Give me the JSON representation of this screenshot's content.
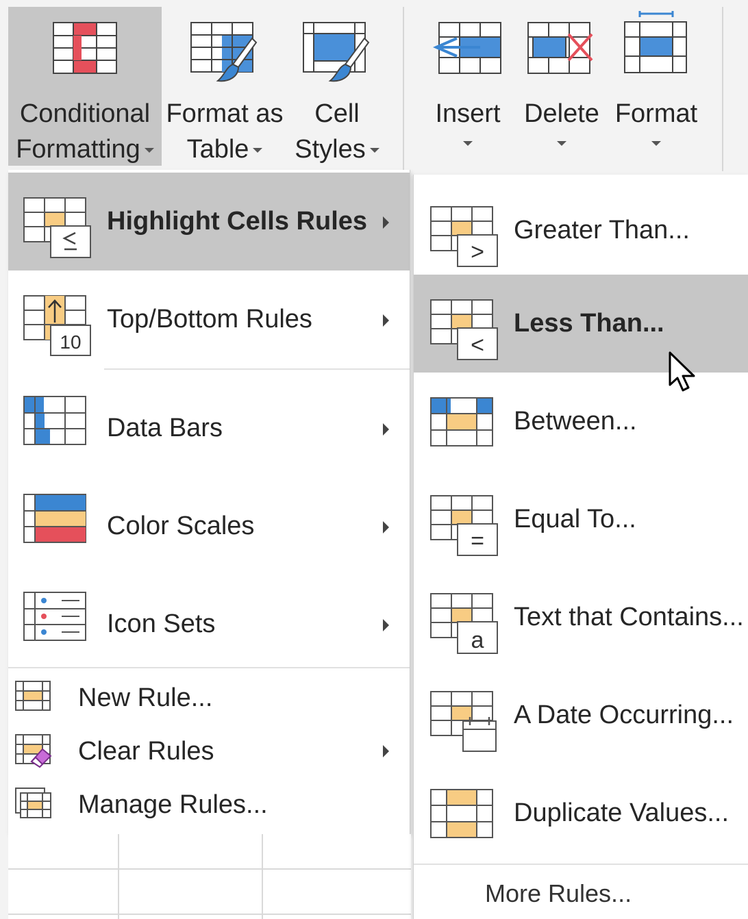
{
  "ribbon": {
    "buttons": [
      {
        "line1": "Conditional",
        "line2": "Formatting",
        "icon": "conditional-formatting-icon",
        "active": true
      },
      {
        "line1": "Format as",
        "line2": "Table",
        "icon": "format-as-table-icon"
      },
      {
        "line1": "Cell",
        "line2": "Styles",
        "icon": "cell-styles-icon"
      },
      {
        "line1": "Insert",
        "line2": "",
        "icon": "insert-cells-icon"
      },
      {
        "line1": "Delete",
        "line2": "",
        "icon": "delete-cells-icon"
      },
      {
        "line1": "Format",
        "line2": "",
        "icon": "format-cells-icon"
      }
    ]
  },
  "menu": {
    "items": [
      {
        "label": "Highlight Cells Rules",
        "icon": "highlight-cells-rules-icon",
        "highlighted": true,
        "submenu": true
      },
      {
        "label": "Top/Bottom Rules",
        "icon": "top-bottom-rules-icon",
        "submenu": true,
        "icon_text": "10"
      },
      {
        "label": "Data Bars",
        "icon": "data-bars-icon",
        "submenu": true
      },
      {
        "label": "Color Scales",
        "icon": "color-scales-icon",
        "submenu": true
      },
      {
        "label": "Icon Sets",
        "icon": "icon-sets-icon",
        "submenu": true
      }
    ],
    "small_items": [
      {
        "label": "New Rule...",
        "icon": "new-rule-icon",
        "submenu": false
      },
      {
        "label": "Clear Rules",
        "icon": "clear-rules-icon",
        "submenu": true
      },
      {
        "label": "Manage Rules...",
        "icon": "manage-rules-icon",
        "submenu": false
      }
    ]
  },
  "submenu": {
    "items": [
      {
        "label": "Greater Than...",
        "icon": "greater-than-icon",
        "symbol": ">"
      },
      {
        "label": "Less Than...",
        "icon": "less-than-icon",
        "symbol": "<",
        "highlighted": true
      },
      {
        "label": "Between...",
        "icon": "between-icon",
        "symbol": ""
      },
      {
        "label": "Equal To...",
        "icon": "equal-to-icon",
        "symbol": "="
      },
      {
        "label": "Text that Contains...",
        "icon": "text-contains-icon",
        "symbol": "a"
      },
      {
        "label": "A Date Occurring...",
        "icon": "date-occurring-icon",
        "symbol": ""
      },
      {
        "label": "Duplicate Values...",
        "icon": "duplicate-values-icon",
        "symbol": ""
      }
    ],
    "more_rules": "More Rules..."
  },
  "colors": {
    "highlight": "#c6c6c6",
    "menu_bg": "#ffffff",
    "ribbon_bg": "#f3f3f3",
    "orange_fill": "#f8cc83",
    "blue_fill": "#3b86d2",
    "red_fill": "#e5505b",
    "icon_stroke": "#444444"
  }
}
